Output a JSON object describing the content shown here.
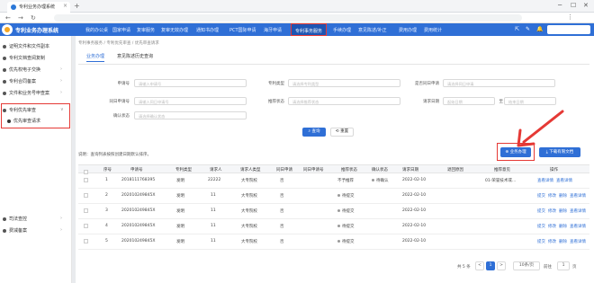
{
  "browser": {
    "tab_title": "专利业务办理系统",
    "tab_close": "×",
    "new_tab": "+",
    "controls": [
      "─",
      "☐",
      "✕"
    ],
    "menu_dots": "⋮"
  },
  "app": {
    "title": "专利业务办理系统",
    "menu": [
      "我的办公桌",
      "国家申请",
      "复审服务",
      "复审无效办理",
      "通知书办理",
      "PCT国际申请",
      "海牙申请",
      "专利事务服务",
      "手续办理",
      "意见陈述/补正",
      "费用办理",
      "费用统计"
    ],
    "active_menu": "专利事务服务",
    "header_icons": [
      "⇱",
      "✎",
      "🔔"
    ]
  },
  "sidebar": {
    "items": [
      {
        "label": "证明文件和文件副本",
        "chev": ""
      },
      {
        "label": "专利文档查阅复制",
        "chev": ""
      },
      {
        "label": "优先权电子交换",
        "chev": "›"
      },
      {
        "label": "专利合同备案",
        "chev": "›"
      },
      {
        "label": "文件和业务号申查案",
        "chev": "›"
      },
      {
        "label": "专利优先审查",
        "chev": "∨"
      },
      {
        "label": "司法查控",
        "chev": "›"
      },
      {
        "label": "费减备案",
        "chev": "›"
      }
    ],
    "sub_item": "优先审查请求"
  },
  "main": {
    "breadcrumb": "专利事务服务  /  专利优先审查  /  优先审查请求",
    "tabs": [
      "业务办理",
      "意见陈述历史查询"
    ],
    "form": {
      "fields": [
        {
          "label": "申请号",
          "placeholder": "请输入申请号"
        },
        {
          "label": "专利类型",
          "placeholder": "请选择专利类型"
        },
        {
          "label": "是否同日申请",
          "placeholder": "请选择同日申请"
        },
        {
          "label": "同日申请号",
          "placeholder": "请输入同日申请号"
        },
        {
          "label": "推荐状态",
          "placeholder": "请选择推荐状态"
        },
        {
          "label": "请求日期",
          "placeholder": "起始日期"
        },
        {
          "label": "",
          "placeholder": "结束日期"
        },
        {
          "label": "确认状态",
          "placeholder": "请选择确认状态"
        }
      ],
      "date_sep": "至",
      "search_btn": "⌕ 查询",
      "reset_btn": "⟲ 重置"
    },
    "note": "说明：查询列表按照创建日期默认排序。",
    "biz_btn": "⊕ 业务办理",
    "download_btn": "⤓ 下载有限文档",
    "table": {
      "headers": [
        "序号",
        "申请号",
        "专利类型",
        "请求人",
        "请求人类型",
        "同日申请",
        "同日申请号",
        "推荐状态",
        "确认状态",
        "请求日期",
        "退回原因",
        "推荐意见",
        "操作"
      ],
      "rows": [
        {
          "no": "1",
          "app": "2018111768395",
          "type": "发明",
          "req": "22222",
          "reqtype": "大专院校",
          "same": "否",
          "sameno": "",
          "rec": "不予推荐",
          "conf": "待确认",
          "date": "2022-02-10",
          "reason": "",
          "opinion": "01-荣誉技术或…",
          "ops": [
            "查看详情",
            "查看详情"
          ]
        },
        {
          "no": "2",
          "app": "202010249845X",
          "type": "发明",
          "req": "11",
          "reqtype": "大专院校",
          "same": "否",
          "sameno": "",
          "rec": "待提交",
          "conf": "",
          "date": "2022-02-10",
          "reason": "",
          "opinion": "",
          "ops": [
            "提交",
            "修改",
            "删除",
            "查看详情"
          ]
        },
        {
          "no": "3",
          "app": "202010249845X",
          "type": "发明",
          "req": "11",
          "reqtype": "大专院校",
          "same": "否",
          "sameno": "",
          "rec": "待提交",
          "conf": "",
          "date": "2022-02-10",
          "reason": "",
          "opinion": "",
          "ops": [
            "提交",
            "修改",
            "删除",
            "查看详情"
          ]
        },
        {
          "no": "4",
          "app": "202010249845X",
          "type": "发明",
          "req": "11",
          "reqtype": "大专院校",
          "same": "否",
          "sameno": "",
          "rec": "待提交",
          "conf": "",
          "date": "2022-02-10",
          "reason": "",
          "opinion": "",
          "ops": [
            "提交",
            "修改",
            "删除",
            "查看详情"
          ]
        },
        {
          "no": "5",
          "app": "202010249845X",
          "type": "发明",
          "req": "11",
          "reqtype": "大专院校",
          "same": "否",
          "sameno": "",
          "rec": "待提交",
          "conf": "",
          "date": "2022-02-10",
          "reason": "",
          "opinion": "",
          "ops": [
            "提交",
            "修改",
            "删除",
            "查看详情"
          ]
        }
      ]
    },
    "pagination": {
      "total": "共 5 条",
      "prev": "<",
      "page": "1",
      "next": ">",
      "size": "10条/页",
      "goto": "前往",
      "goto_val": "1",
      "page_unit": "页"
    }
  },
  "colors": {
    "brand": "#2f6fd6",
    "highlight": "#e53935"
  }
}
